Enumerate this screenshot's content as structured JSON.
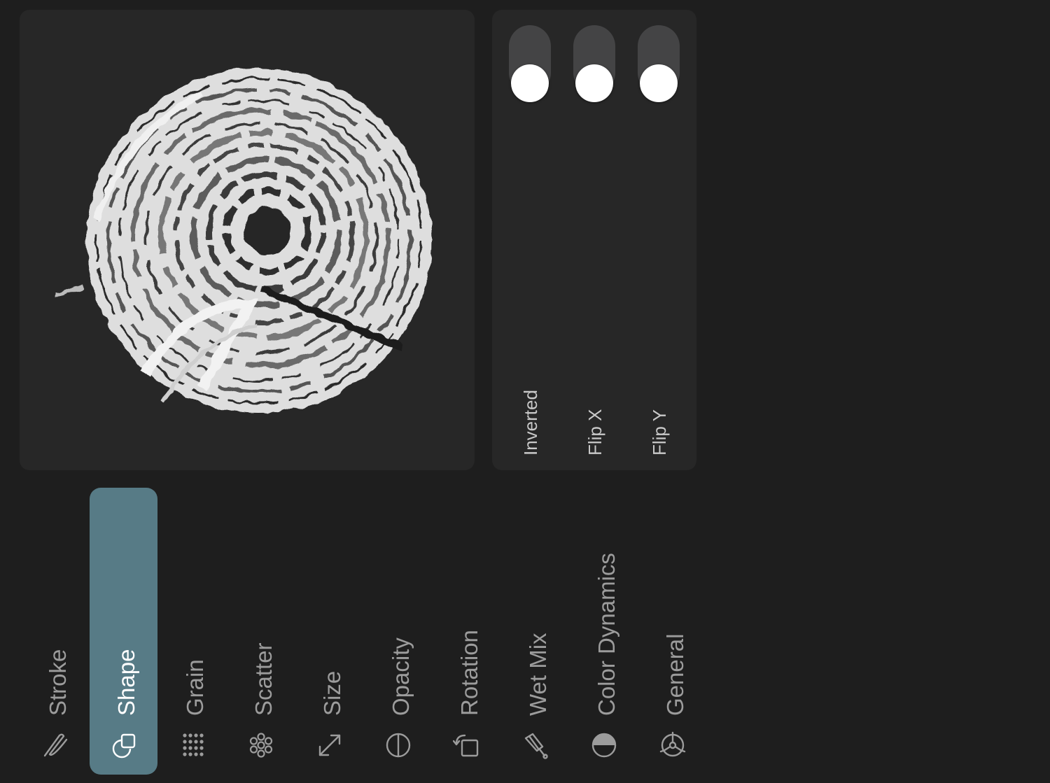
{
  "preview": {
    "shape_icon": "circular-swirl-brush-shape"
  },
  "toggles": [
    {
      "label": "Inverted",
      "on": false
    },
    {
      "label": "Flip X",
      "on": false
    },
    {
      "label": "Flip Y",
      "on": false
    }
  ],
  "nav": {
    "items": [
      {
        "label": "Stroke",
        "icon": "stroke-icon"
      },
      {
        "label": "Shape",
        "icon": "shape-icon",
        "active": true
      },
      {
        "label": "Grain",
        "icon": "grain-icon"
      },
      {
        "label": "Scatter",
        "icon": "scatter-icon"
      },
      {
        "label": "Size",
        "icon": "size-icon"
      },
      {
        "label": "Opacity",
        "icon": "opacity-icon"
      },
      {
        "label": "Rotation",
        "icon": "rotation-icon"
      },
      {
        "label": "Wet Mix",
        "icon": "wet-mix-icon"
      },
      {
        "label": "Color Dynamics",
        "icon": "color-dynamics-icon"
      },
      {
        "label": "General",
        "icon": "general-icon"
      }
    ]
  },
  "colors": {
    "background": "#1e1e1e",
    "panel": "#272727",
    "accent": "#577b86",
    "toggle_track": "#444445",
    "knob": "#ffffff"
  }
}
